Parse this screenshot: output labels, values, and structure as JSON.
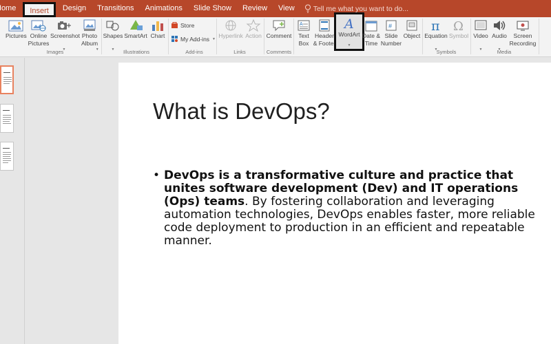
{
  "tabs": [
    {
      "label": "Home"
    },
    {
      "label": "Insert"
    },
    {
      "label": "Design"
    },
    {
      "label": "Transitions"
    },
    {
      "label": "Animations"
    },
    {
      "label": "Slide Show"
    },
    {
      "label": "Review"
    },
    {
      "label": "View"
    }
  ],
  "tellme": "Tell me what you want to do...",
  "ribbon": {
    "pictures": "Pictures",
    "online_pictures": "Online\nPictures",
    "screenshot": "Screenshot",
    "photo_album": "Photo\nAlbum",
    "shapes": "Shapes",
    "smartart": "SmartArt",
    "chart": "Chart",
    "store": "Store",
    "my_addins": "My Add-ins",
    "hyperlink": "Hyperlink",
    "action": "Action",
    "comment": "Comment",
    "text_box": "Text\nBox",
    "header_footer": "Header\n& Footer",
    "wordart": "WordArt",
    "date_time": "Date &\nTime",
    "slide_number": "Slide\nNumber",
    "object": "Object",
    "equation": "Equation",
    "symbol": "Symbol",
    "video": "Video",
    "audio": "Audio",
    "screen_recording": "Screen\nRecording"
  },
  "groups": {
    "images": "Images",
    "illustrations": "Illustrations",
    "addins": "Add-ins",
    "links": "Links",
    "comments": "Comments",
    "symbols": "Symbols",
    "media": "Media"
  },
  "slide": {
    "title": "What is DevOps?",
    "bullet_bold": "DevOps is a transformative culture and practice that unites software development (Dev) and IT operations (Ops) teams",
    "bullet_rest": ". By fostering collaboration and leveraging automation technologies, DevOps enables faster, more reliable code deployment to production in an efficient and repeatable manner."
  },
  "colors": {
    "accent": "#b7472a",
    "ribbon_bg": "#f3f3f3",
    "selected_thumb": "#e8825f"
  }
}
